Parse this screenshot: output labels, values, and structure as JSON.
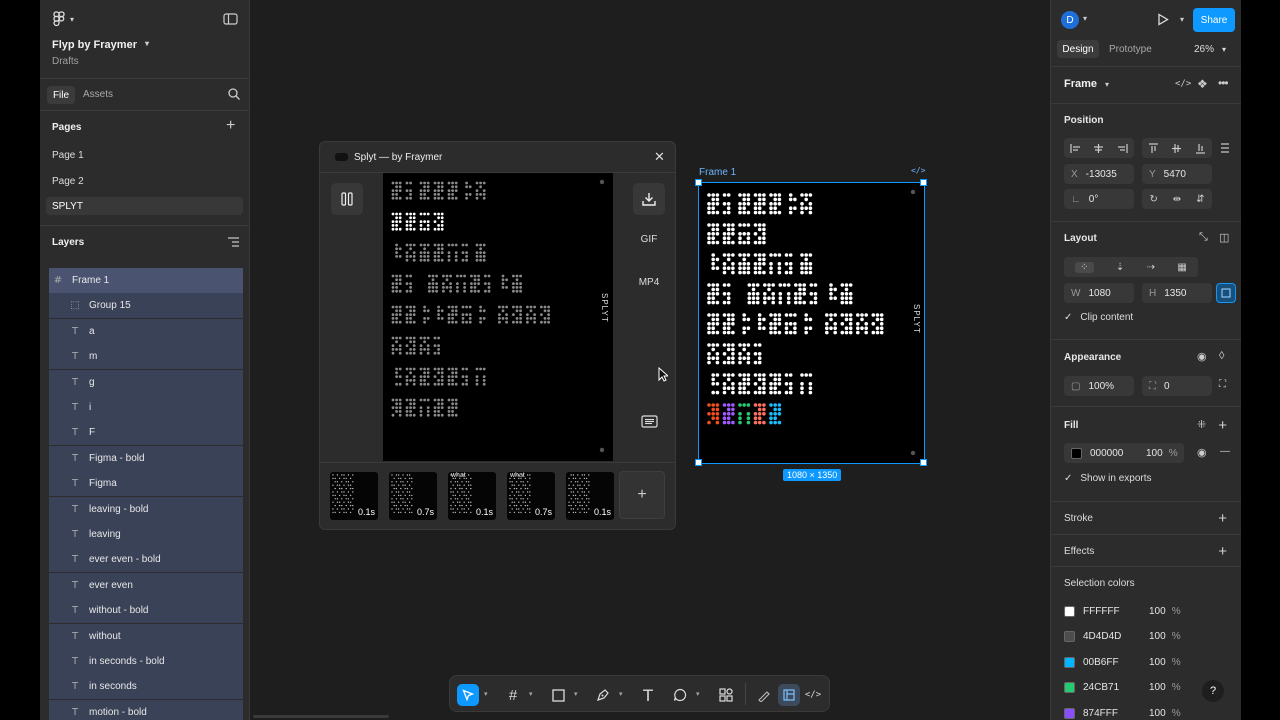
{
  "app": {
    "file_title": "Flyp by Fraymer",
    "location": "Drafts"
  },
  "left_panel": {
    "tabs": [
      "File",
      "Assets"
    ],
    "pages_title": "Pages",
    "pages": [
      "Page 1",
      "Page 2",
      "SPLYT"
    ],
    "layers_title": "Layers",
    "layers": [
      {
        "name": "Frame 1",
        "kind": "frame-icon"
      },
      {
        "name": "Group 15",
        "kind": "group-icon"
      },
      {
        "name": "a",
        "kind": "text-icon"
      },
      {
        "name": "m",
        "kind": "text-icon"
      },
      {
        "name": "g",
        "kind": "text-icon"
      },
      {
        "name": "i",
        "kind": "text-icon"
      },
      {
        "name": "F",
        "kind": "text-icon"
      },
      {
        "name": "Figma - bold",
        "kind": "text-icon"
      },
      {
        "name": "Figma",
        "kind": "text-icon"
      },
      {
        "name": "leaving - bold",
        "kind": "text-icon"
      },
      {
        "name": "leaving",
        "kind": "text-icon"
      },
      {
        "name": "ever even - bold",
        "kind": "text-icon"
      },
      {
        "name": "ever even",
        "kind": "text-icon"
      },
      {
        "name": "without - bold",
        "kind": "text-icon"
      },
      {
        "name": "without",
        "kind": "text-icon"
      },
      {
        "name": "in seconds - bold",
        "kind": "text-icon"
      },
      {
        "name": "in seconds",
        "kind": "text-icon"
      },
      {
        "name": "motion - bold",
        "kind": "text-icon"
      }
    ]
  },
  "plugin": {
    "title": "Splyt — by Fraymer",
    "export_gif": "GIF",
    "export_mp4": "MP4",
    "side_text": "SPLYT",
    "preview_words": [
      "Animate",
      "your",
      "designs",
      "in seconds",
      "without ever",
      "even",
      "leaving",
      "Figma"
    ],
    "frames": [
      {
        "duration": "0.1s",
        "word": ""
      },
      {
        "duration": "0.7s",
        "word": ""
      },
      {
        "duration": "0.1s",
        "word": "what"
      },
      {
        "duration": "0.7s",
        "word": "what"
      },
      {
        "duration": "0.1s",
        "word": ""
      }
    ]
  },
  "canvas": {
    "frame_label": "Frame 1",
    "size_badge": "1080 × 1350",
    "side_text": "SPLYT",
    "words": [
      "Animate",
      "your",
      "designs",
      "in seconds",
      "without ever",
      "even",
      "leaving",
      "Figma"
    ]
  },
  "right_panel": {
    "avatar_letter": "D",
    "share_label": "Share",
    "tabs": [
      "Design",
      "Prototype"
    ],
    "zoom": "26%",
    "selection_type": "Frame",
    "position_title": "Position",
    "x_label": "X",
    "x_value": "-13035",
    "y_label": "Y",
    "y_value": "5470",
    "rotation": "0°",
    "layout_title": "Layout",
    "w_label": "W",
    "w_value": "1080",
    "h_label": "H",
    "h_value": "1350",
    "clip_content": "Clip content",
    "appearance_title": "Appearance",
    "opacity": "100%",
    "radius": "0",
    "fill_title": "Fill",
    "fill_hex": "000000",
    "fill_opacity": "100",
    "percent": "%",
    "show_in_exports": "Show in exports",
    "stroke_title": "Stroke",
    "effects_title": "Effects",
    "selection_colors_title": "Selection colors",
    "selection_colors": [
      {
        "hex": "FFFFFF",
        "opacity": "100",
        "color": "#FFFFFF"
      },
      {
        "hex": "4D4D4D",
        "opacity": "100",
        "color": "#4D4D4D"
      },
      {
        "hex": "00B6FF",
        "opacity": "100",
        "color": "#00B6FF"
      },
      {
        "hex": "24CB71",
        "opacity": "100",
        "color": "#24CB71"
      },
      {
        "hex": "874FFF",
        "opacity": "100",
        "color": "#874FFF"
      }
    ]
  },
  "colors": {
    "accent": "#0d99ff",
    "selection_blue": "#3a4258"
  }
}
